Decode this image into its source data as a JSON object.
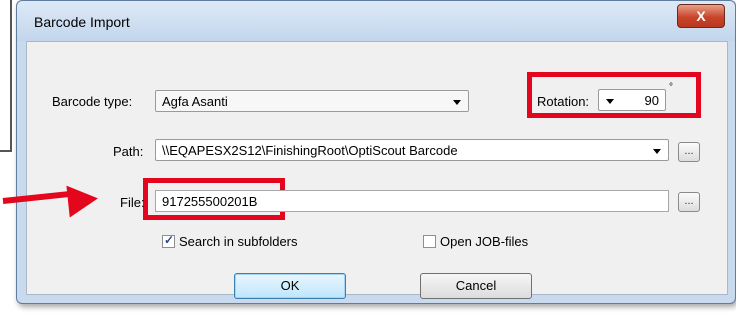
{
  "window": {
    "title": "Barcode Import",
    "close_label": "X"
  },
  "barcode_type": {
    "label": "Barcode type:",
    "value": "Agfa Asanti"
  },
  "rotation": {
    "label": "Rotation:",
    "value": "90",
    "unit": "°"
  },
  "path": {
    "label": "Path:",
    "value": "\\\\EQAPESX2S12\\FinishingRoot\\OptiScout Barcode",
    "browse_label": "..."
  },
  "file": {
    "label": "File:",
    "value": "917255500201B",
    "browse_label": "..."
  },
  "options": {
    "search_subfolders": {
      "label": "Search in subfolders",
      "checked": true
    },
    "open_job_files": {
      "label": "Open JOB-files",
      "checked": false
    }
  },
  "buttons": {
    "ok": "OK",
    "cancel": "Cancel"
  },
  "colors": {
    "highlight": "#e3061c",
    "title_bg": "#c9daee",
    "content_bg": "#f0f0f0"
  }
}
